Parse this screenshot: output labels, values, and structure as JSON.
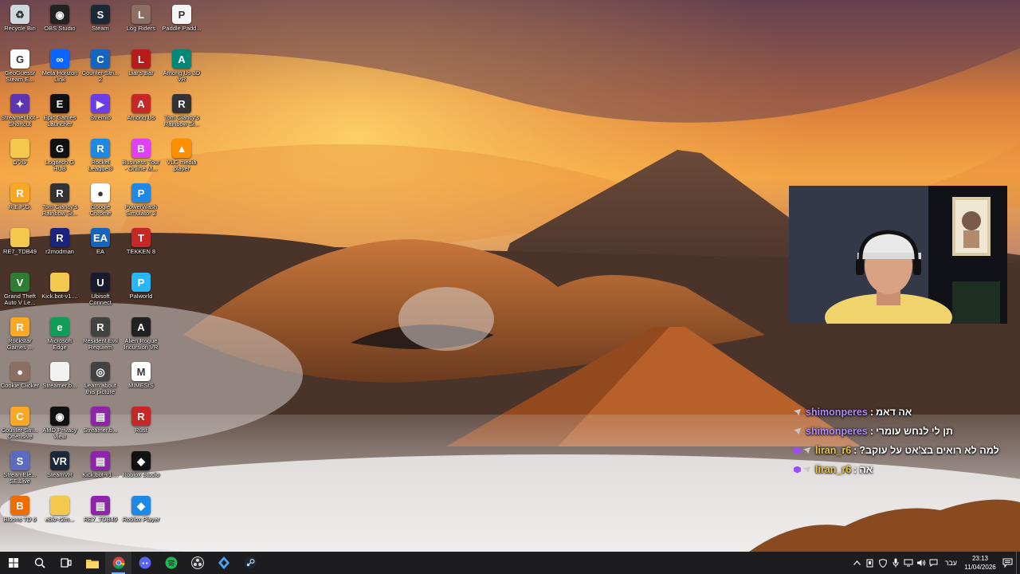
{
  "desktop": {
    "icons": [
      {
        "label": "Recycle Bin",
        "name": "recycle-bin-icon",
        "color": "#cfd8dc",
        "glyph": "♻"
      },
      {
        "label": "OBS Studio",
        "name": "obs-studio-icon",
        "color": "#222222",
        "glyph": "◉"
      },
      {
        "label": "Steam",
        "name": "steam-icon",
        "color": "#1b2838",
        "glyph": "S"
      },
      {
        "label": "Log Riders",
        "name": "log-riders-icon",
        "color": "#8d6e63",
        "glyph": "L"
      },
      {
        "label": "Paddle Padd...",
        "name": "paddle-paddle-icon",
        "color": "#f5f5f5",
        "glyph": "P"
      },
      {
        "label": "GeoGuessr Steam E...",
        "name": "geoguessr-icon",
        "color": "#ffffff",
        "glyph": "G"
      },
      {
        "label": "Meta Horizon Link",
        "name": "meta-horizon-link-icon",
        "color": "#0a66ff",
        "glyph": "∞"
      },
      {
        "label": "Counter-Stri... 2",
        "name": "counter-strike-2-icon",
        "color": "#1565c0",
        "glyph": "C"
      },
      {
        "label": "Liar's Bar",
        "name": "liars-bar-icon",
        "color": "#b71c1c",
        "glyph": "L"
      },
      {
        "label": "Among Us 3D VR",
        "name": "among-us-3d-vr-icon",
        "color": "#00897b",
        "glyph": "A"
      },
      {
        "label": "Streamer.bot - Shortcut",
        "name": "streamer-bot-shortcut-icon",
        "color": "#5e35b1",
        "glyph": "✦"
      },
      {
        "label": "Epic Games Launcher",
        "name": "epic-games-launcher-icon",
        "color": "#111111",
        "glyph": "E"
      },
      {
        "label": "Stremio",
        "name": "stremio-icon",
        "color": "#6a3de8",
        "glyph": "▶"
      },
      {
        "label": "Among Us",
        "name": "among-us-icon",
        "color": "#c62828",
        "glyph": "A"
      },
      {
        "label": "Tom Clancy's Rainbow Si...",
        "name": "rainbow-six-icon",
        "color": "#333333",
        "glyph": "R"
      },
      {
        "label": "עולים",
        "name": "hebrew-folder-icon",
        "color": "#f2c94c",
        "glyph": ""
      },
      {
        "label": "Logitech G HUB",
        "name": "logitech-g-hub-icon",
        "color": "#111111",
        "glyph": "G"
      },
      {
        "label": "Rocket League®",
        "name": "rocket-league-icon",
        "color": "#1e88e5",
        "glyph": "R"
      },
      {
        "label": "Business Tour - Online M...",
        "name": "business-tour-icon",
        "color": "#e040fb",
        "glyph": "B"
      },
      {
        "label": "VLC media player",
        "name": "vlc-media-player-icon",
        "color": "#ff8f00",
        "glyph": "▲"
      },
      {
        "label": "R.E.P.O.",
        "name": "repo-icon",
        "color": "#f9a825",
        "glyph": "R"
      },
      {
        "label": "Tom Clancy's Rainbow Si...",
        "name": "rainbow-six-2-icon",
        "color": "#333333",
        "glyph": "R"
      },
      {
        "label": "Google Chrome",
        "name": "google-chrome-icon",
        "color": "#ffffff",
        "glyph": "●"
      },
      {
        "label": "PowerWash Simulator 2",
        "name": "powerwash-simulator-2-icon",
        "color": "#1e88e5",
        "glyph": "P"
      },
      {
        "label": "",
        "name": "empty-slot",
        "color": "transparent",
        "glyph": ""
      },
      {
        "label": "RE7_TDB49",
        "name": "re7-folder-icon",
        "color": "#f2c94c",
        "glyph": ""
      },
      {
        "label": "r2modman",
        "name": "r2modman-icon",
        "color": "#1a237e",
        "glyph": "R"
      },
      {
        "label": "EA",
        "name": "ea-icon",
        "color": "#1565c0",
        "glyph": "EA"
      },
      {
        "label": "TEKKEN 8",
        "name": "tekken-8-icon",
        "color": "#c62828",
        "glyph": "T"
      },
      {
        "label": "",
        "name": "empty-slot",
        "color": "transparent",
        "glyph": ""
      },
      {
        "label": "Grand Theft Auto V Le...",
        "name": "gta-v-icon",
        "color": "#2e7d32",
        "glyph": "V"
      },
      {
        "label": "Kick.bot-v1....",
        "name": "kick-bot-folder-icon",
        "color": "#f2c94c",
        "glyph": ""
      },
      {
        "label": "Ubisoft Connect",
        "name": "ubisoft-connect-icon",
        "color": "#1a1a2e",
        "glyph": "U"
      },
      {
        "label": "Palworld",
        "name": "palworld-icon",
        "color": "#29b6f6",
        "glyph": "P"
      },
      {
        "label": "",
        "name": "empty-slot",
        "color": "transparent",
        "glyph": ""
      },
      {
        "label": "Rockstar Games ...",
        "name": "rockstar-games-icon",
        "color": "#f9a825",
        "glyph": "R"
      },
      {
        "label": "Microsoft Edge",
        "name": "microsoft-edge-icon",
        "color": "#0f9d58",
        "glyph": "e"
      },
      {
        "label": "Resident Evil Requiem",
        "name": "resident-evil-requiem-icon",
        "color": "#424242",
        "glyph": "R"
      },
      {
        "label": "Alien Rogue Incursion VR",
        "name": "alien-rogue-incursion-icon",
        "color": "#212121",
        "glyph": "A"
      },
      {
        "label": "",
        "name": "empty-slot",
        "color": "transparent",
        "glyph": ""
      },
      {
        "label": "Cookie Clicker",
        "name": "cookie-clicker-icon",
        "color": "#8d6e63",
        "glyph": "●"
      },
      {
        "label": "Streamer.b...",
        "name": "streamer-bot-folder-icon",
        "color": "#f2f2f2",
        "glyph": ""
      },
      {
        "label": "Learn about this picture",
        "name": "learn-about-picture-icon",
        "color": "#424242",
        "glyph": "◎"
      },
      {
        "label": "MIMESIS",
        "name": "mimesis-icon",
        "color": "#ffffff",
        "glyph": "M"
      },
      {
        "label": "",
        "name": "empty-slot",
        "color": "transparent",
        "glyph": ""
      },
      {
        "label": "Counter-Stri... Offensive",
        "name": "counter-strike-go-icon",
        "color": "#f9a825",
        "glyph": "C"
      },
      {
        "label": "AMD Privacy View",
        "name": "amd-privacy-view-icon",
        "color": "#111111",
        "glyph": "◉"
      },
      {
        "label": "Streamer.b...",
        "name": "streamer-bot-archive-icon",
        "color": "#8e24aa",
        "glyph": "▤"
      },
      {
        "label": "Rust",
        "name": "rust-icon",
        "color": "#c62828",
        "glyph": "R"
      },
      {
        "label": "",
        "name": "empty-slot",
        "color": "transparent",
        "glyph": ""
      },
      {
        "label": "StreamEle... SE.Live",
        "name": "streamelements-icon",
        "color": "#5c6bc0",
        "glyph": "S"
      },
      {
        "label": "SteamVR",
        "name": "steamvr-icon",
        "color": "#1b2838",
        "glyph": "VR"
      },
      {
        "label": "Kick.bot-v1....",
        "name": "kick-bot-archive-icon",
        "color": "#8e24aa",
        "glyph": "▤"
      },
      {
        "label": "Roblox Studio",
        "name": "roblox-studio-icon",
        "color": "#111111",
        "glyph": "◆"
      },
      {
        "label": "",
        "name": "empty-slot",
        "color": "transparent",
        "glyph": ""
      },
      {
        "label": "Bloons TD 6",
        "name": "bloons-td-6-icon",
        "color": "#ef6c00",
        "glyph": "B"
      },
      {
        "label": "ebkr-r2m...",
        "name": "ebkr-folder-icon",
        "color": "#f2c94c",
        "glyph": ""
      },
      {
        "label": "RE7_TDB49",
        "name": "re7-archive-icon",
        "color": "#8e24aa",
        "glyph": "▤"
      },
      {
        "label": "Roblox Player",
        "name": "roblox-player-icon",
        "color": "#1e88e5",
        "glyph": "◆"
      }
    ]
  },
  "chat": {
    "messages": [
      {
        "user": "shimonperes",
        "user_color": "#b18cff",
        "separator": ":",
        "text": "אה דאמ",
        "sub": false
      },
      {
        "user": "shimonperes",
        "user_color": "#b18cff",
        "separator": ":",
        "text": "תן לי לנחש עומרי",
        "sub": false
      },
      {
        "user": "liran_r6",
        "user_color": "#e6c34a",
        "separator": ":",
        "text": "למה לא רואים בצ'אט על עוקב?",
        "sub": true
      },
      {
        "user": "liran_r6",
        "user_color": "#e6c34a",
        "separator": ":",
        "text": "אה",
        "sub": true
      }
    ]
  },
  "taskbar": {
    "apps": [
      {
        "name": "start-button",
        "icon": "windows-icon"
      },
      {
        "name": "search-button",
        "icon": "search-icon"
      },
      {
        "name": "task-view-button",
        "icon": "task-view-icon"
      },
      {
        "name": "file-explorer-button",
        "icon": "folder-icon"
      },
      {
        "name": "chrome-button",
        "icon": "chrome-icon",
        "active": true
      },
      {
        "name": "discord-button",
        "icon": "discord-icon"
      },
      {
        "name": "spotify-button",
        "icon": "spotify-icon"
      },
      {
        "name": "obs-button",
        "icon": "obs-icon"
      },
      {
        "name": "streamer-bot-button",
        "icon": "streamer-bot-icon"
      },
      {
        "name": "steam-button",
        "icon": "steam-icon"
      }
    ],
    "language": "עבר",
    "time": "23:13",
    "date": "11/04/2026"
  }
}
